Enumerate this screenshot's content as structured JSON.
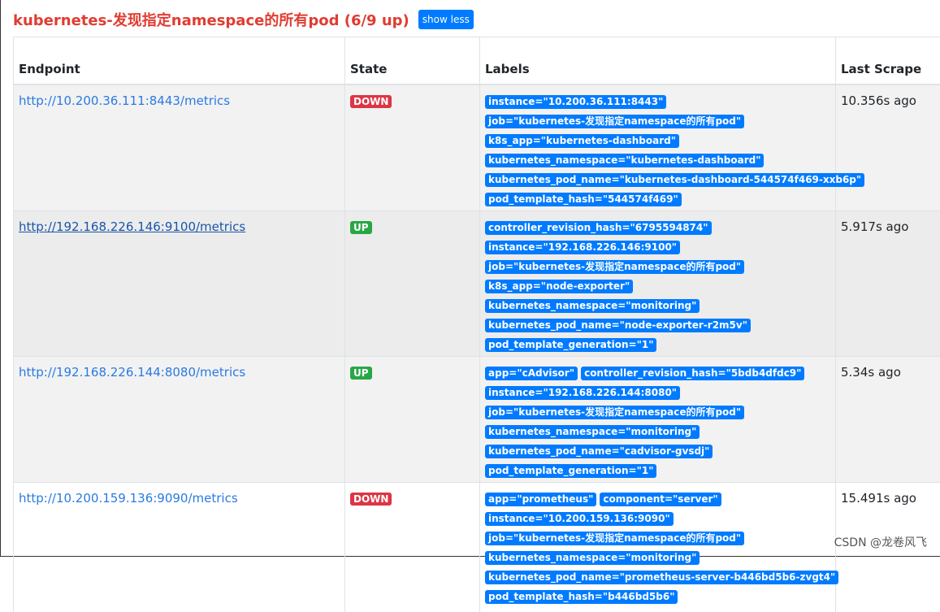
{
  "header": {
    "title": "kubernetes-发现指定namespace的所有pod (6/9 up)",
    "show_less_label": "show less"
  },
  "table": {
    "columns": [
      "Endpoint",
      "State",
      "Labels",
      "Last Scrape"
    ],
    "rows": [
      {
        "endpoint": "http://10.200.36.111:8443/metrics",
        "state": "DOWN",
        "labels": [
          "instance=\"10.200.36.111:8443\"",
          "job=\"kubernetes-发现指定namespace的所有pod\"",
          "k8s_app=\"kubernetes-dashboard\"",
          "kubernetes_namespace=\"kubernetes-dashboard\"",
          "kubernetes_pod_name=\"kubernetes-dashboard-544574f469-xxb6p\"",
          "pod_template_hash=\"544574f469\""
        ],
        "last_scrape": "10.356s ago"
      },
      {
        "endpoint": "http://192.168.226.146:9100/metrics",
        "state": "UP",
        "labels": [
          "controller_revision_hash=\"6795594874\"",
          "instance=\"192.168.226.146:9100\"",
          "job=\"kubernetes-发现指定namespace的所有pod\"",
          "k8s_app=\"node-exporter\"",
          "kubernetes_namespace=\"monitoring\"",
          "kubernetes_pod_name=\"node-exporter-r2m5v\"",
          "pod_template_generation=\"1\""
        ],
        "last_scrape": "5.917s ago"
      },
      {
        "endpoint": "http://192.168.226.144:8080/metrics",
        "state": "UP",
        "labels": [
          "app=\"cAdvisor\"",
          "controller_revision_hash=\"5bdb4dfdc9\"",
          "instance=\"192.168.226.144:8080\"",
          "job=\"kubernetes-发现指定namespace的所有pod\"",
          "kubernetes_namespace=\"monitoring\"",
          "kubernetes_pod_name=\"cadvisor-gvsdj\"",
          "pod_template_generation=\"1\""
        ],
        "last_scrape": "5.34s ago"
      },
      {
        "endpoint": "http://10.200.159.136:9090/metrics",
        "state": "DOWN",
        "labels": [
          "app=\"prometheus\"",
          "component=\"server\"",
          "instance=\"10.200.159.136:9090\"",
          "job=\"kubernetes-发现指定namespace的所有pod\"",
          "kubernetes_namespace=\"monitoring\"",
          "kubernetes_pod_name=\"prometheus-server-b446bd5b6-zvgt4\"",
          "pod_template_hash=\"b446bd5b6\""
        ],
        "last_scrape": "15.491s ago"
      }
    ]
  },
  "watermark": "CSDN @龙卷风飞",
  "colors": {
    "title": "#e03c31",
    "primary": "#007bff",
    "down": "#dc3545",
    "up": "#28a745",
    "link": "#2a7ae2"
  }
}
